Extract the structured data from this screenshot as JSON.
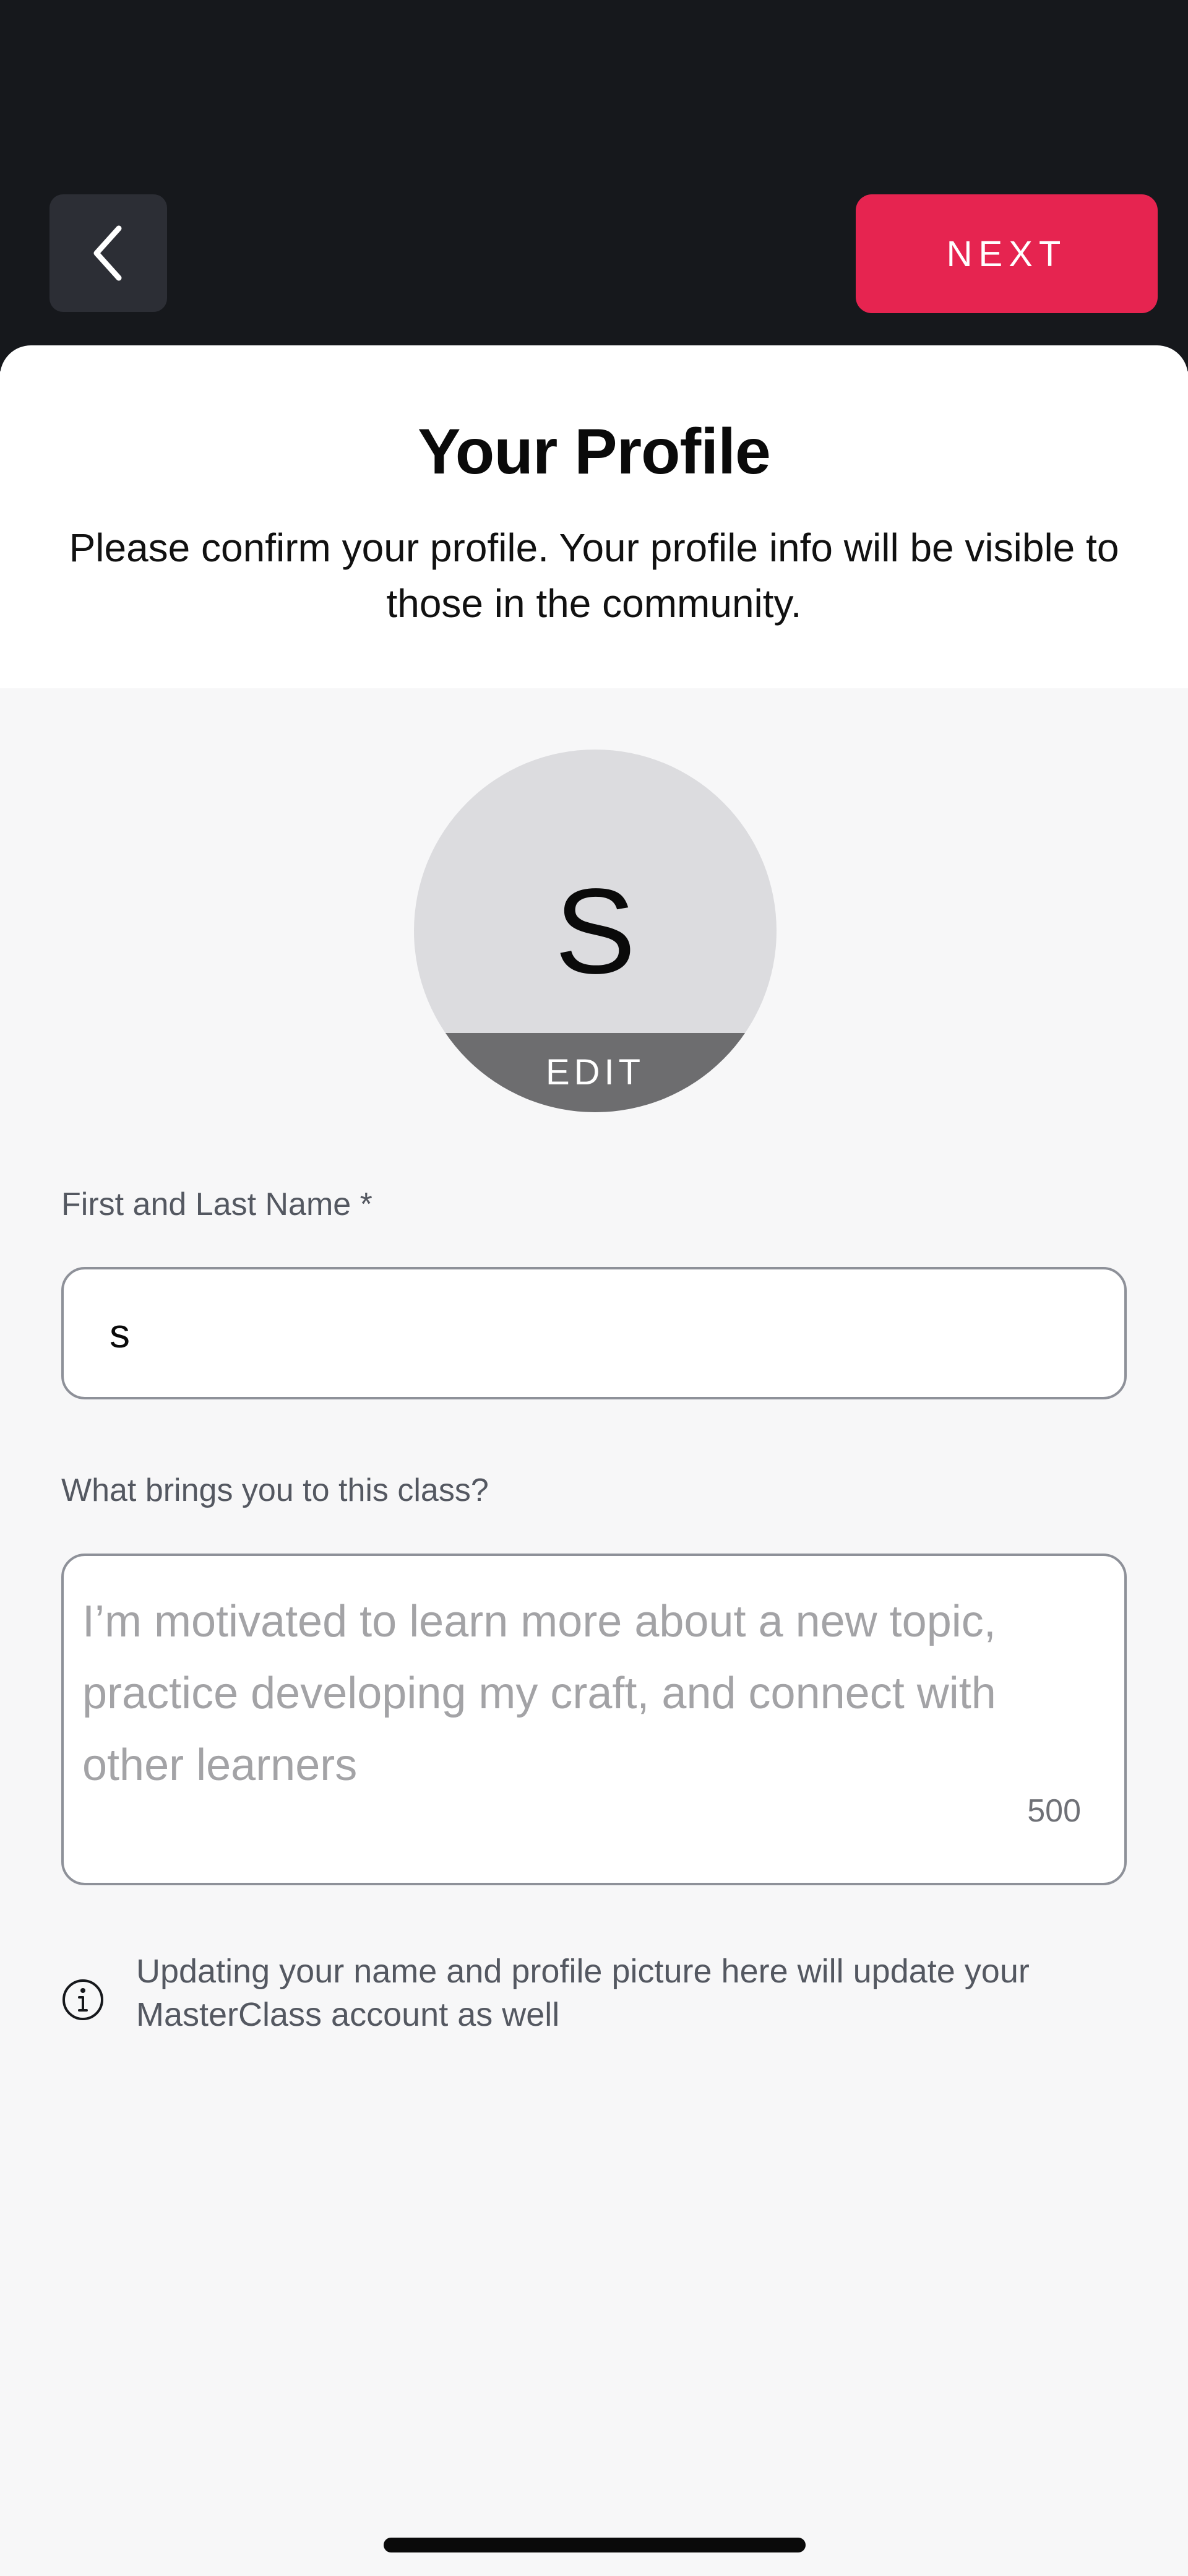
{
  "header": {
    "back_icon": "chevron-left-icon",
    "next_label": "NEXT"
  },
  "profile": {
    "title": "Your Profile",
    "subtitle": "Please confirm your profile. Your profile info will be visible to those in the community."
  },
  "avatar": {
    "initial": "S",
    "edit_label": "EDIT"
  },
  "form": {
    "name_label": "First and Last Name *",
    "name_value": "s",
    "reason_label": "What brings you to this class?",
    "reason_placeholder": "I’m motivated to learn more about a new topic, practice developing my craft, and connect with other learners",
    "reason_char_limit": "500"
  },
  "notice": {
    "icon": "info-icon",
    "text": "Updating your name and profile picture here will update your MasterClass account as well"
  },
  "colors": {
    "top_bar": "#16181C",
    "accent": "#E62450",
    "page_background": "#F7F7F8"
  }
}
